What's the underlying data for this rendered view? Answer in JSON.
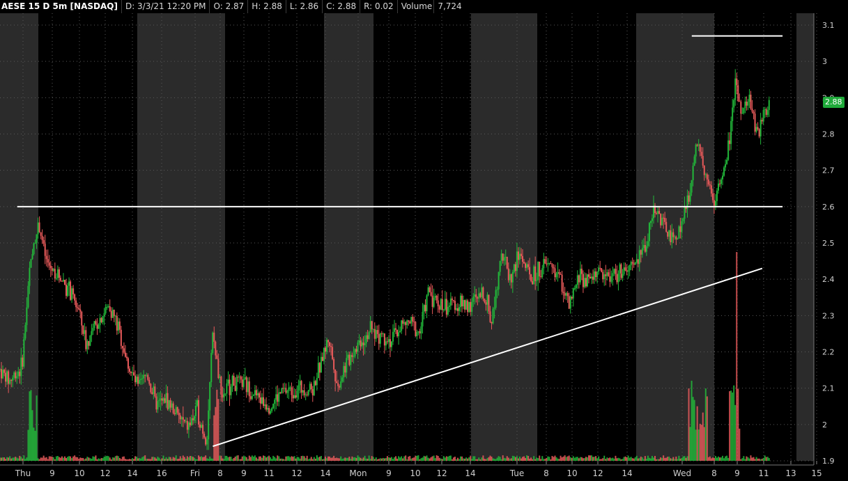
{
  "header": {
    "symbol": "AESE 15 D 5m [NASDAQ]",
    "date": "D: 3/3/21 12:20 PM",
    "open": "O: 2.87",
    "high": "H: 2.88",
    "low": "L: 2.86",
    "close": "C: 2.88",
    "range": "R: 0.02",
    "volume_label": "Volume",
    "volume_value": "7,724"
  },
  "last_price": "2.88",
  "colors": {
    "up": "#22b83a",
    "down": "#e85a5a",
    "session_shade": "#2b2b2b",
    "grid": "#5a5a5a",
    "drawn_lines": "#ffffff",
    "price_badge": "#1faa3a"
  },
  "chart_data": {
    "type": "candlestick",
    "title": "",
    "y_ticks": [
      "1.9",
      "2",
      "2.1",
      "2.2",
      "2.3",
      "2.4",
      "2.5",
      "2.6",
      "2.7",
      "2.8",
      "2.9",
      "3",
      "3.1"
    ],
    "ylim": [
      1.9,
      3.1
    ],
    "x_ticks": [
      "Thu",
      "9",
      "10",
      "12",
      "14",
      "16",
      "Fri",
      "8",
      "9",
      "11",
      "12",
      "14",
      "Mon",
      "9",
      "10",
      "12",
      "14",
      "Tue",
      "8",
      "10",
      "12",
      "14",
      "Wed",
      "8",
      "9",
      "11",
      "13",
      "15"
    ],
    "grid": true,
    "price_path": [
      [
        0.0,
        2.15
      ],
      [
        0.6,
        2.12
      ],
      [
        1.4,
        2.16
      ],
      [
        2.0,
        2.48
      ],
      [
        2.5,
        2.55
      ],
      [
        3.0,
        2.44
      ],
      [
        4.0,
        2.4
      ],
      [
        5.0,
        2.32
      ],
      [
        5.5,
        2.22
      ],
      [
        6.2,
        2.28
      ],
      [
        7.0,
        2.33
      ],
      [
        7.6,
        2.26
      ],
      [
        8.2,
        2.16
      ],
      [
        8.8,
        2.1
      ],
      [
        9.4,
        2.14
      ],
      [
        10.0,
        2.05
      ],
      [
        10.6,
        2.07
      ],
      [
        11.4,
        2.02
      ],
      [
        12.0,
        1.99
      ],
      [
        12.6,
        2.04
      ],
      [
        13.2,
        1.95
      ],
      [
        13.6,
        2.25
      ],
      [
        14.2,
        2.08
      ],
      [
        14.8,
        2.12
      ],
      [
        15.6,
        2.11
      ],
      [
        16.4,
        2.08
      ],
      [
        17.2,
        2.05
      ],
      [
        18.0,
        2.09
      ],
      [
        19.0,
        2.1
      ],
      [
        20.0,
        2.1
      ],
      [
        21.0,
        2.24
      ],
      [
        21.6,
        2.1
      ],
      [
        22.0,
        2.16
      ],
      [
        22.8,
        2.22
      ],
      [
        23.6,
        2.26
      ],
      [
        24.4,
        2.25
      ],
      [
        25.0,
        2.23
      ],
      [
        25.6,
        2.27
      ],
      [
        26.2,
        2.28
      ],
      [
        26.8,
        2.25
      ],
      [
        27.4,
        2.37
      ],
      [
        28.0,
        2.33
      ],
      [
        29.0,
        2.33
      ],
      [
        30.0,
        2.33
      ],
      [
        31.0,
        2.36
      ],
      [
        31.4,
        2.28
      ],
      [
        32.0,
        2.48
      ],
      [
        32.6,
        2.4
      ],
      [
        33.2,
        2.47
      ],
      [
        34.0,
        2.4
      ],
      [
        34.6,
        2.43
      ],
      [
        35.2,
        2.44
      ],
      [
        35.8,
        2.4
      ],
      [
        36.4,
        2.32
      ],
      [
        37.0,
        2.41
      ],
      [
        37.6,
        2.4
      ],
      [
        38.2,
        2.42
      ],
      [
        39.0,
        2.41
      ],
      [
        40.0,
        2.42
      ],
      [
        40.6,
        2.44
      ],
      [
        41.2,
        2.49
      ],
      [
        41.8,
        2.6
      ],
      [
        42.4,
        2.55
      ],
      [
        43.0,
        2.5
      ],
      [
        43.6,
        2.56
      ],
      [
        44.0,
        2.62
      ],
      [
        44.6,
        2.8
      ],
      [
        45.0,
        2.7
      ],
      [
        45.6,
        2.62
      ],
      [
        46.2,
        2.68
      ],
      [
        46.6,
        2.78
      ],
      [
        47.0,
        2.95
      ],
      [
        47.4,
        2.85
      ],
      [
        47.8,
        2.9
      ],
      [
        48.4,
        2.8
      ],
      [
        48.8,
        2.85
      ],
      [
        49.2,
        2.88
      ]
    ],
    "horizontal_lines": [
      {
        "price": 2.6,
        "from": 1.1,
        "to": 50.0
      },
      {
        "price": 3.07,
        "from": 44.2,
        "to": 50.0
      }
    ],
    "trendline": {
      "from": [
        13.6,
        1.94
      ],
      "to": [
        48.7,
        2.43
      ]
    }
  }
}
